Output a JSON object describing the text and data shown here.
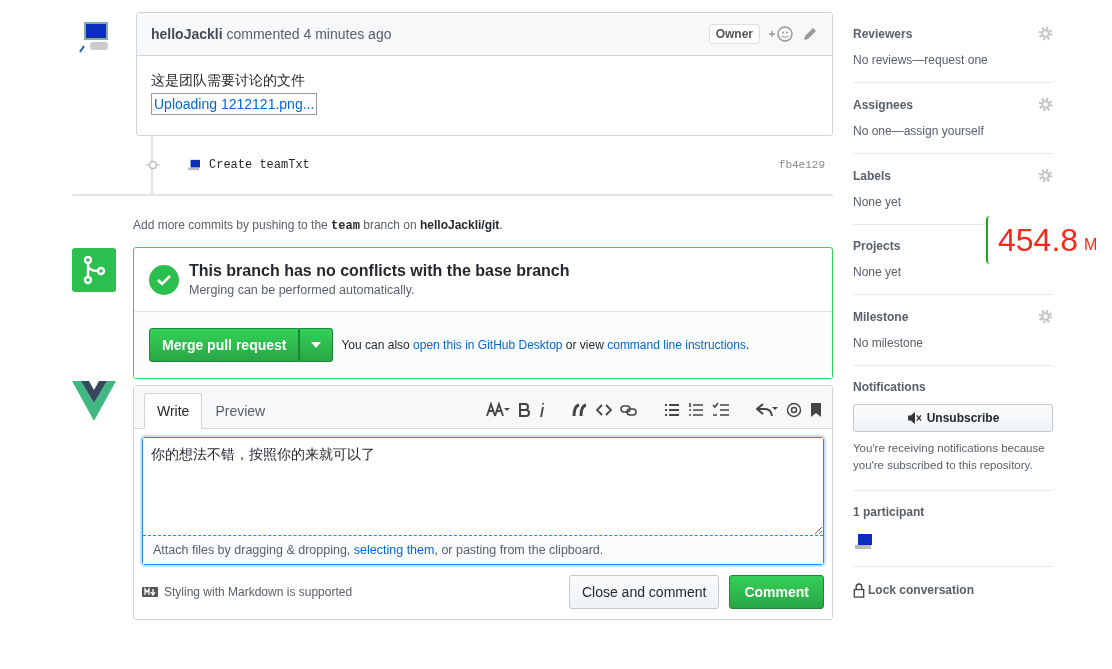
{
  "comment": {
    "author": "helloJackli",
    "action": "commented 4 minutes ago",
    "badge": "Owner",
    "body": "这是团队需要讨论的文件",
    "attachment": "Uploading 1212121.png..."
  },
  "commit": {
    "message": "Create teamTxt",
    "sha": "fb4e129"
  },
  "push_hint": "Add more commits by pushing to the **team** branch on **helloJackli/git**.",
  "merge": {
    "title": "This branch has no conflicts with the base branch",
    "subtitle": "Merging can be performed automatically.",
    "button": "Merge pull request",
    "hint_before": "You can also",
    "link1": "open this in GitHub Desktop",
    "hint_middle": "or view",
    "link2": "command line instructions",
    "hint_end": "."
  },
  "editor": {
    "tabs": [
      {
        "label": "Write",
        "selected": true
      },
      {
        "label": "Preview",
        "selected": false
      }
    ],
    "value": "你的想法不错，按照你的来就可以了",
    "attach_before": "Attach files by dragging & dropping,",
    "attach_link": "selecting them",
    "attach_after": ", or pasting from the clipboard.",
    "markdown_note": "Styling with Markdown is supported",
    "buttons": [
      {
        "label": "Close and comment",
        "kind": "secondary"
      },
      {
        "label": "Comment",
        "kind": "primary"
      }
    ]
  },
  "sidebar": {
    "sections": [
      {
        "title": "Reviewers",
        "value": "No reviews—request one",
        "gear": true
      },
      {
        "title": "Assignees",
        "value": "No one—assign yourself",
        "gear": true
      },
      {
        "title": "Labels",
        "value": "None yet",
        "gear": true
      },
      {
        "title": "Projects",
        "value": "None yet",
        "gear": false
      },
      {
        "title": "Milestone",
        "value": "No milestone",
        "gear": true
      }
    ],
    "notifications": {
      "title": "Notifications",
      "button": "Unsubscribe",
      "note": "You're receiving notifications because you're subscribed to this repository."
    },
    "participants": {
      "title": "1 participant"
    },
    "lock": "Lock conversation"
  },
  "overlay": {
    "value": "454.8",
    "unit": "M"
  }
}
